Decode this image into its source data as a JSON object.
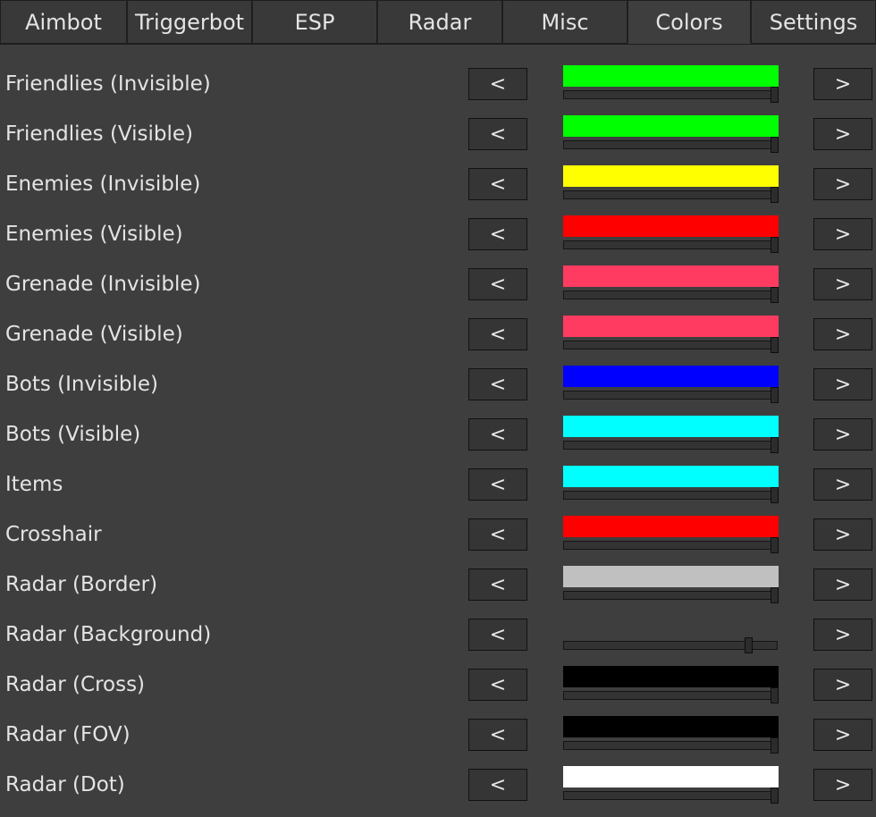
{
  "tabs": [
    {
      "label": "Aimbot",
      "active": false
    },
    {
      "label": "Triggerbot",
      "active": false
    },
    {
      "label": "ESP",
      "active": false
    },
    {
      "label": "Radar",
      "active": false
    },
    {
      "label": "Misc",
      "active": false
    },
    {
      "label": "Colors",
      "active": true
    },
    {
      "label": "Settings",
      "active": false
    }
  ],
  "prev_label": "<",
  "next_label": ">",
  "rows": [
    {
      "label": "Friendlies (Invisible)",
      "color": "#00ff00",
      "alpha": 1.0
    },
    {
      "label": "Friendlies (Visible)",
      "color": "#00ff00",
      "alpha": 1.0
    },
    {
      "label": "Enemies (Invisible)",
      "color": "#ffff00",
      "alpha": 1.0
    },
    {
      "label": "Enemies (Visible)",
      "color": "#ff0000",
      "alpha": 1.0
    },
    {
      "label": "Grenade (Invisible)",
      "color": "#ff3b61",
      "alpha": 1.0
    },
    {
      "label": "Grenade (Visible)",
      "color": "#ff3b61",
      "alpha": 1.0
    },
    {
      "label": "Bots (Invisible)",
      "color": "#0000ff",
      "alpha": 1.0
    },
    {
      "label": "Bots (Visible)",
      "color": "#00ffff",
      "alpha": 1.0
    },
    {
      "label": "Items",
      "color": "#00ffff",
      "alpha": 1.0
    },
    {
      "label": "Crosshair",
      "color": "#ff0000",
      "alpha": 1.0
    },
    {
      "label": "Radar (Border)",
      "color": "#c0c0c0",
      "alpha": 1.0
    },
    {
      "label": "Radar (Background)",
      "color": "#3e3e3e",
      "alpha": 0.88
    },
    {
      "label": "Radar (Cross)",
      "color": "#000000",
      "alpha": 1.0
    },
    {
      "label": "Radar (FOV)",
      "color": "#000000",
      "alpha": 1.0
    },
    {
      "label": "Radar (Dot)",
      "color": "#ffffff",
      "alpha": 1.0
    }
  ]
}
